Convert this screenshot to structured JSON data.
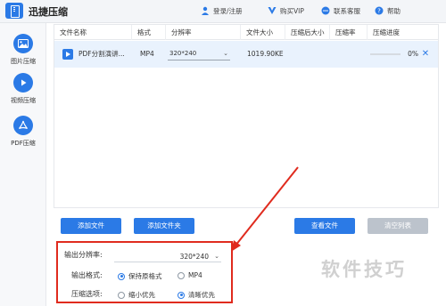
{
  "app": {
    "title": "迅捷压缩"
  },
  "header": {
    "login_label": "登录/注册",
    "vip_label": "购买VIP",
    "support_label": "联系客服",
    "help_label": "帮助"
  },
  "sidebar": {
    "items": [
      {
        "label": "图片压缩",
        "icon": "image-icon",
        "color": "#2b7ae6"
      },
      {
        "label": "视频压缩",
        "icon": "play-icon",
        "color": "#2b7ae6"
      },
      {
        "label": "PDF压缩",
        "icon": "pdf-icon",
        "color": "#2b7ae6"
      }
    ]
  },
  "table": {
    "columns": [
      "文件名称",
      "格式",
      "分辨率",
      "文件大小",
      "压缩后大小",
      "压缩率",
      "压缩进度"
    ],
    "rows": [
      {
        "name": "PDF分割演讲...",
        "format": "MP4",
        "resolution": "320*240",
        "size": "1019.90KE",
        "compressed_size": "",
        "ratio": "",
        "progress_text": "0%",
        "progress": 0
      }
    ]
  },
  "actions": {
    "add_file": "添加文件",
    "add_folder": "添加文件夹",
    "view_file": "查看文件",
    "clear_list": "清空列表"
  },
  "settings": {
    "resolution_label": "输出分辨率:",
    "resolution_value": "320*240",
    "format_label": "输出格式:",
    "format_options": [
      "保持原格式",
      "MP4"
    ],
    "format_selected": "保持原格式",
    "compress_label": "压缩选项:",
    "compress_options": [
      "缩小优先",
      "清晰优先"
    ],
    "compress_selected": "清晰优先"
  },
  "watermark": "软件技巧",
  "colors": {
    "accent": "#2b7ae6",
    "annotation_red": "#e02b1e",
    "disabled_button": "#bcc3cc"
  }
}
